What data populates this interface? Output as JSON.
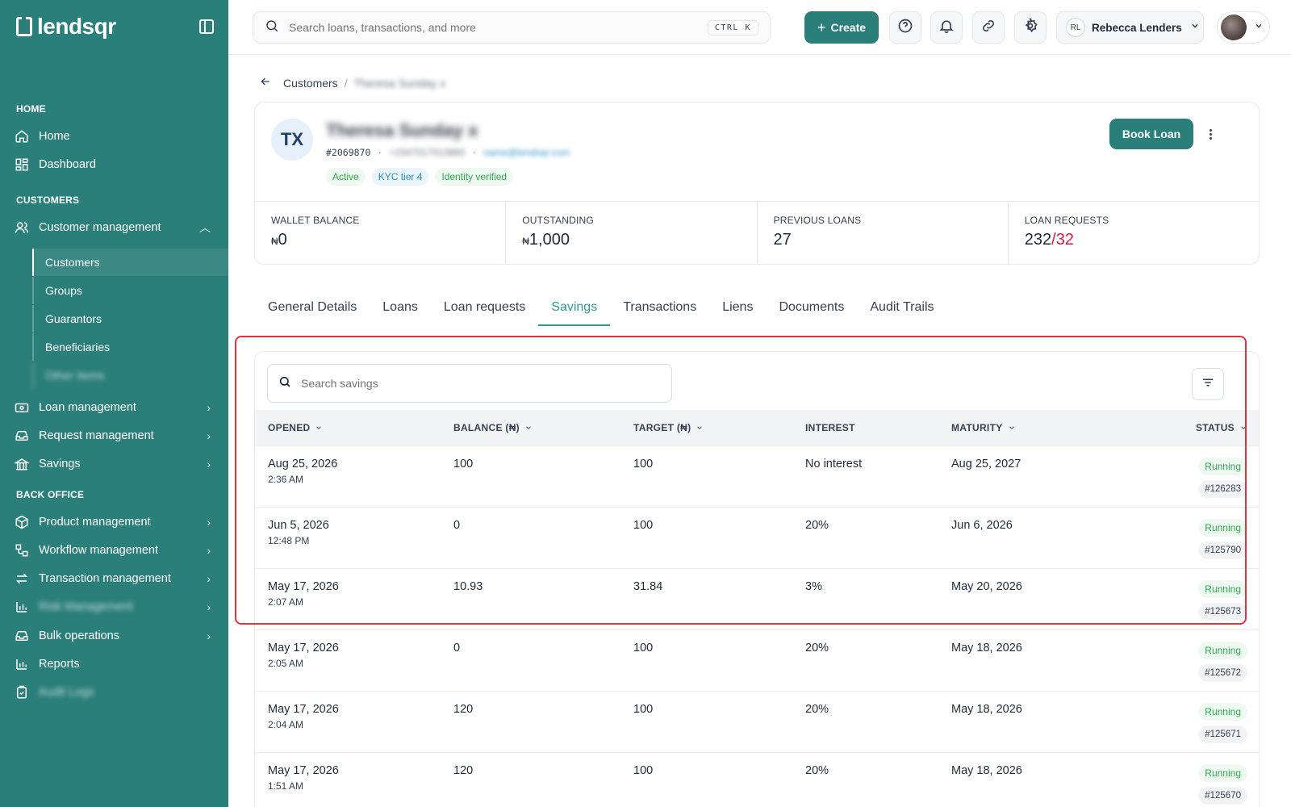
{
  "brand": {
    "name": "lendsqr"
  },
  "sidebar": {
    "sections": [
      {
        "label": "HOME"
      },
      {
        "label": "CUSTOMERS"
      },
      {
        "label": "BACK OFFICE"
      }
    ],
    "home": "Home",
    "dashboard": "Dashboard",
    "customer_management": "Customer management",
    "sub": [
      "Customers",
      "Groups",
      "Guarantors",
      "Beneficiaries",
      "Other Items"
    ],
    "loan_management": "Loan management",
    "request_management": "Request management",
    "savings": "Savings",
    "product_management": "Product management",
    "workflow_management": "Workflow management",
    "transaction_management": "Transaction management",
    "hidden_item_1": "Risk Management",
    "bulk_operations": "Bulk operations",
    "reports": "Reports",
    "hidden_item_2": "Audit Logs"
  },
  "topbar": {
    "search_placeholder": "Search loans, transactions, and more",
    "shortcut": "CTRL K",
    "create_label": "Create",
    "user_initials": "RL",
    "user_name": "Rebecca Lenders"
  },
  "breadcrumb": {
    "parent": "Customers",
    "separator": "/",
    "current": "Theresa Sunday x"
  },
  "customer": {
    "initials": "TX",
    "name": "Theresa Sunday x",
    "id": "#2069870",
    "phone": "+2347017013883",
    "email": "name@lendsqr.com",
    "badges": [
      "Active",
      "KYC tier 4",
      "Identity verified"
    ],
    "book_loan_label": "Book Loan"
  },
  "stats": {
    "wallet_balance_label": "WALLET BALANCE",
    "wallet_balance_currency": "₦",
    "wallet_balance_value": "0",
    "outstanding_label": "OUTSTANDING",
    "outstanding_currency": "₦",
    "outstanding_value": "1,000",
    "previous_loans_label": "PREVIOUS LOANS",
    "previous_loans_value": "27",
    "loan_requests_label": "LOAN REQUESTS",
    "loan_requests_total": "232",
    "loan_requests_separator": "/",
    "loan_requests_pending": "32"
  },
  "tabs": [
    "General Details",
    "Loans",
    "Loan requests",
    "Savings",
    "Transactions",
    "Liens",
    "Documents",
    "Audit Trails"
  ],
  "active_tab": "Savings",
  "savings": {
    "search_placeholder": "Search savings",
    "columns": {
      "opened": "OPENED",
      "balance": "BALANCE (₦)",
      "target": "TARGET (₦)",
      "interest": "INTEREST",
      "maturity": "MATURITY",
      "status": "STATUS"
    },
    "rows": [
      {
        "date": "Aug 25, 2026",
        "time": "2:36 AM",
        "balance": "100",
        "target": "100",
        "interest": "No interest",
        "maturity": "Aug 25, 2027",
        "status": "Running",
        "id": "#126283"
      },
      {
        "date": "Jun 5, 2026",
        "time": "12:48 PM",
        "balance": "0",
        "target": "100",
        "interest": "20%",
        "maturity": "Jun 6, 2026",
        "status": "Running",
        "id": "#125790"
      },
      {
        "date": "May 17, 2026",
        "time": "2:07 AM",
        "balance": "10.93",
        "target": "31.84",
        "interest": "3%",
        "maturity": "May 20, 2026",
        "status": "Running",
        "id": "#125673"
      },
      {
        "date": "May 17, 2026",
        "time": "2:05 AM",
        "balance": "0",
        "target": "100",
        "interest": "20%",
        "maturity": "May 18, 2026",
        "status": "Running",
        "id": "#125672"
      },
      {
        "date": "May 17, 2026",
        "time": "2:04 AM",
        "balance": "120",
        "target": "100",
        "interest": "20%",
        "maturity": "May 18, 2026",
        "status": "Running",
        "id": "#125671"
      },
      {
        "date": "May 17, 2026",
        "time": "1:51 AM",
        "balance": "120",
        "target": "100",
        "interest": "20%",
        "maturity": "May 18, 2026",
        "status": "Running",
        "id": "#125670"
      }
    ]
  },
  "colors": {
    "brand": "#2b7f7a",
    "accent": "#2b9a94",
    "highlight": "#e0323f",
    "success": "#2fa84f",
    "danger": "#d81b45"
  }
}
